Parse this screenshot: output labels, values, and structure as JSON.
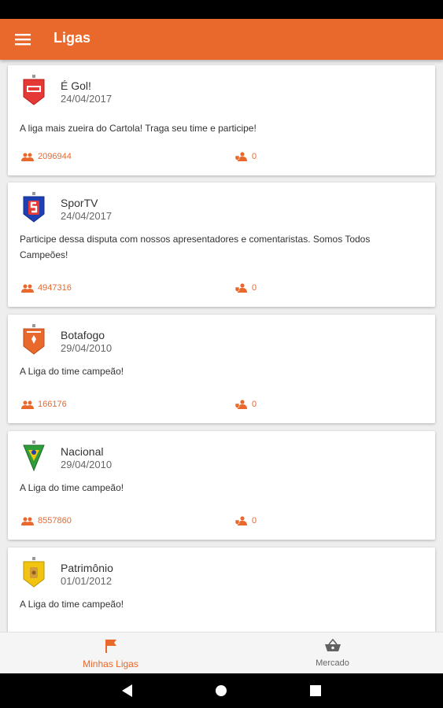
{
  "app": {
    "title": "Ligas",
    "accent": "#e9682b"
  },
  "leagues": [
    {
      "name": "É Gol!",
      "date": "24/04/2017",
      "description": "A liga mais zueira do Cartola! Traga seu time e participe!",
      "members": "2096944",
      "teams": "0",
      "badge_color": "#e53935"
    },
    {
      "name": "SporTV",
      "date": "24/04/2017",
      "description": "Participe dessa disputa com nossos apresentadores e comentaristas. Somos Todos Campeões!",
      "members": "4947316",
      "teams": "0",
      "badge_color": "#1e40b4"
    },
    {
      "name": "Botafogo",
      "date": "29/04/2010",
      "description": "A Liga do time campeão!",
      "members": "166176",
      "teams": "0",
      "badge_color": "#e9682b"
    },
    {
      "name": "Nacional",
      "date": "29/04/2010",
      "description": "A Liga do time campeão!",
      "members": "8557860",
      "teams": "0",
      "badge_color": "#2e9d3a"
    },
    {
      "name": "Patrimônio",
      "date": "01/01/2012",
      "description": "A Liga do time campeão!",
      "members": "",
      "teams": "",
      "badge_color": "#f1c40f"
    }
  ],
  "bottom_nav": {
    "minhas_ligas": "Minhas Ligas",
    "mercado": "Mercado"
  },
  "icons": {
    "menu": "menu-icon",
    "members": "group-icon",
    "teams": "shield-group-icon",
    "minhas_ligas": "flag-icon",
    "mercado": "basket-icon"
  }
}
